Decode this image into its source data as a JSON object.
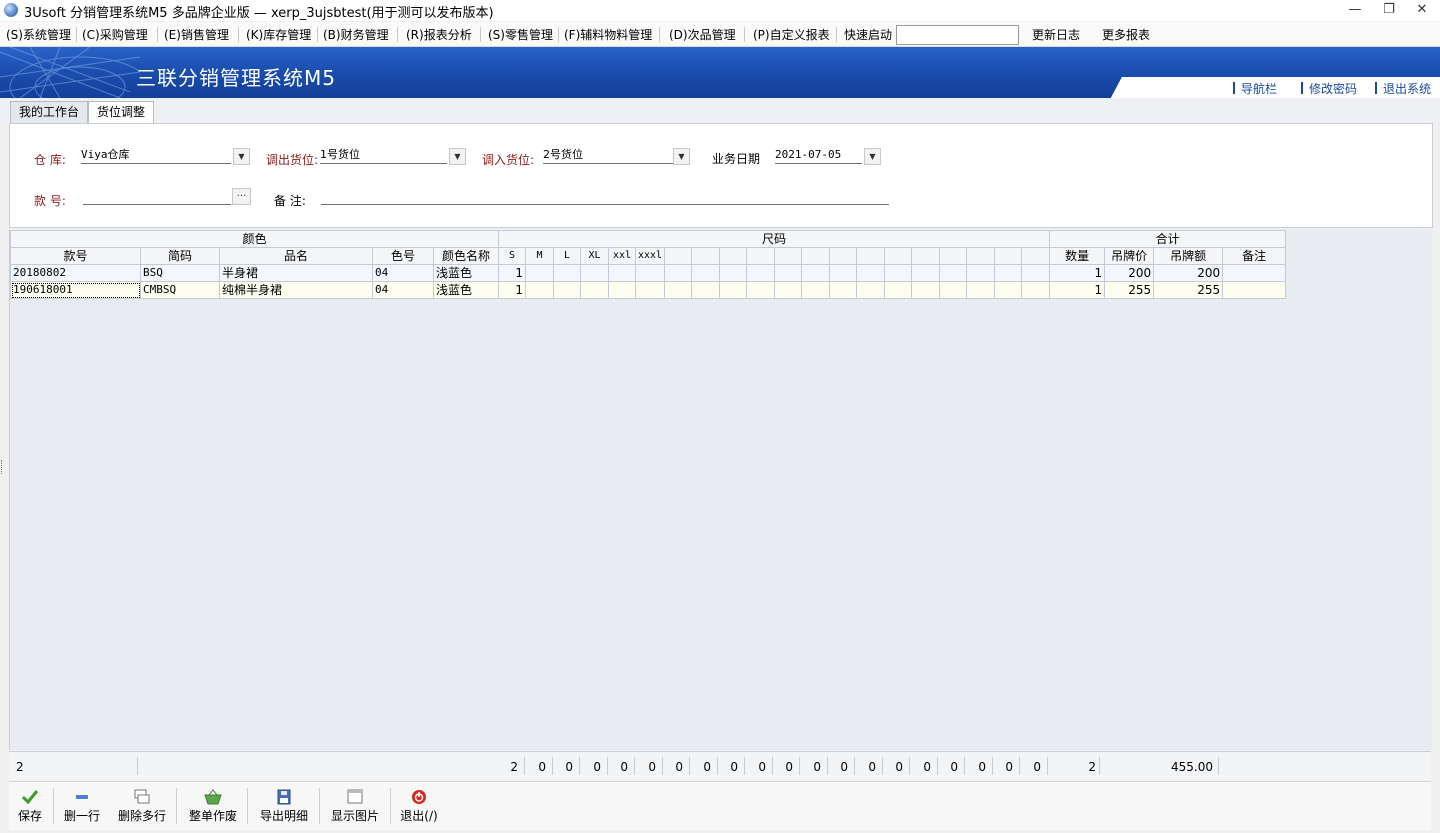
{
  "window": {
    "title": "3Usoft 分销管理系统M5 多品牌企业版 — xerp_3ujsbtest(用于测可以发布版本)",
    "minimize": "—",
    "restore": "❐",
    "close": "✕"
  },
  "menubar": {
    "items": [
      "(S)系统管理",
      "(C)采购管理",
      "(E)销售管理",
      "(K)库存管理",
      "(B)财务管理",
      "(R)报表分析",
      "(S)零售管理",
      "(F)辅料物料管理",
      "(D)次品管理",
      "(P)自定义报表"
    ],
    "quick_launch_label": "快速启动",
    "quick_launch_value": "",
    "update_log": "更新日志",
    "more_reports": "更多报表"
  },
  "banner": {
    "title": "三联分销管理系统M5",
    "links": [
      "导航栏",
      "修改密码",
      "退出系统"
    ]
  },
  "tabs": [
    "我的工作台",
    "货位调整"
  ],
  "form": {
    "warehouse_label": "仓  库:",
    "warehouse_value": "Viya仓库",
    "out_location_label": "调出货位:",
    "out_location_value": "1号货位",
    "in_location_label": "调入货位:",
    "in_location_value": "2号货位",
    "business_date_label": "业务日期",
    "business_date_value": "2021-07-05",
    "style_no_label": "款  号:",
    "style_no_value": "",
    "browse_button": "···",
    "remark_label": "备  注:",
    "remark_value": ""
  },
  "grid": {
    "group_headers": {
      "color": "颜色",
      "size": "尺码",
      "total": "合计"
    },
    "columns": [
      "款号",
      "简码",
      "品名",
      "色号",
      "颜色名称",
      "S",
      "M",
      "L",
      "XL",
      "xxl",
      "xxxl",
      "",
      "",
      "",
      "",
      "",
      "",
      "",
      "",
      "",
      "",
      "",
      "",
      "",
      "",
      "数量",
      "吊牌价",
      "吊牌额",
      "备注"
    ],
    "rows": [
      [
        "20180802",
        "BSQ",
        "半身裙",
        "04",
        "浅蓝色",
        "1",
        "",
        "",
        "",
        "",
        "",
        "",
        "",
        "",
        "",
        "",
        "",
        "",
        "",
        "",
        "",
        "",
        "",
        "",
        "",
        "1",
        "200",
        "200",
        ""
      ],
      [
        "190618001",
        "CMBSQ",
        "纯棉半身裙",
        "04",
        "浅蓝色",
        "1",
        "",
        "",
        "",
        "",
        "",
        "",
        "",
        "",
        "",
        "",
        "",
        "",
        "",
        "",
        "",
        "",
        "",
        "",
        "",
        "1",
        "255",
        "255",
        ""
      ]
    ]
  },
  "summary": {
    "row_count": "2",
    "size_totals": [
      "2",
      "0",
      "0",
      "0",
      "0",
      "0",
      "0",
      "0",
      "0",
      "0",
      "0",
      "0",
      "0",
      "0",
      "0",
      "0",
      "0",
      "0",
      "0",
      "0"
    ],
    "qty_total": "2",
    "amount_total": "455.00"
  },
  "toolbar": {
    "save": "保存",
    "delete_row": "删一行",
    "delete_rows": "删除多行",
    "void_doc": "整单作废",
    "export_detail": "导出明细",
    "show_image": "显示图片",
    "exit": "退出(/)"
  },
  "colors": {
    "banner": "#1b4fb0",
    "label_red": "#8b1b1b",
    "exit_icon": "#d9261c",
    "save_icon": "#3a9a2a"
  }
}
